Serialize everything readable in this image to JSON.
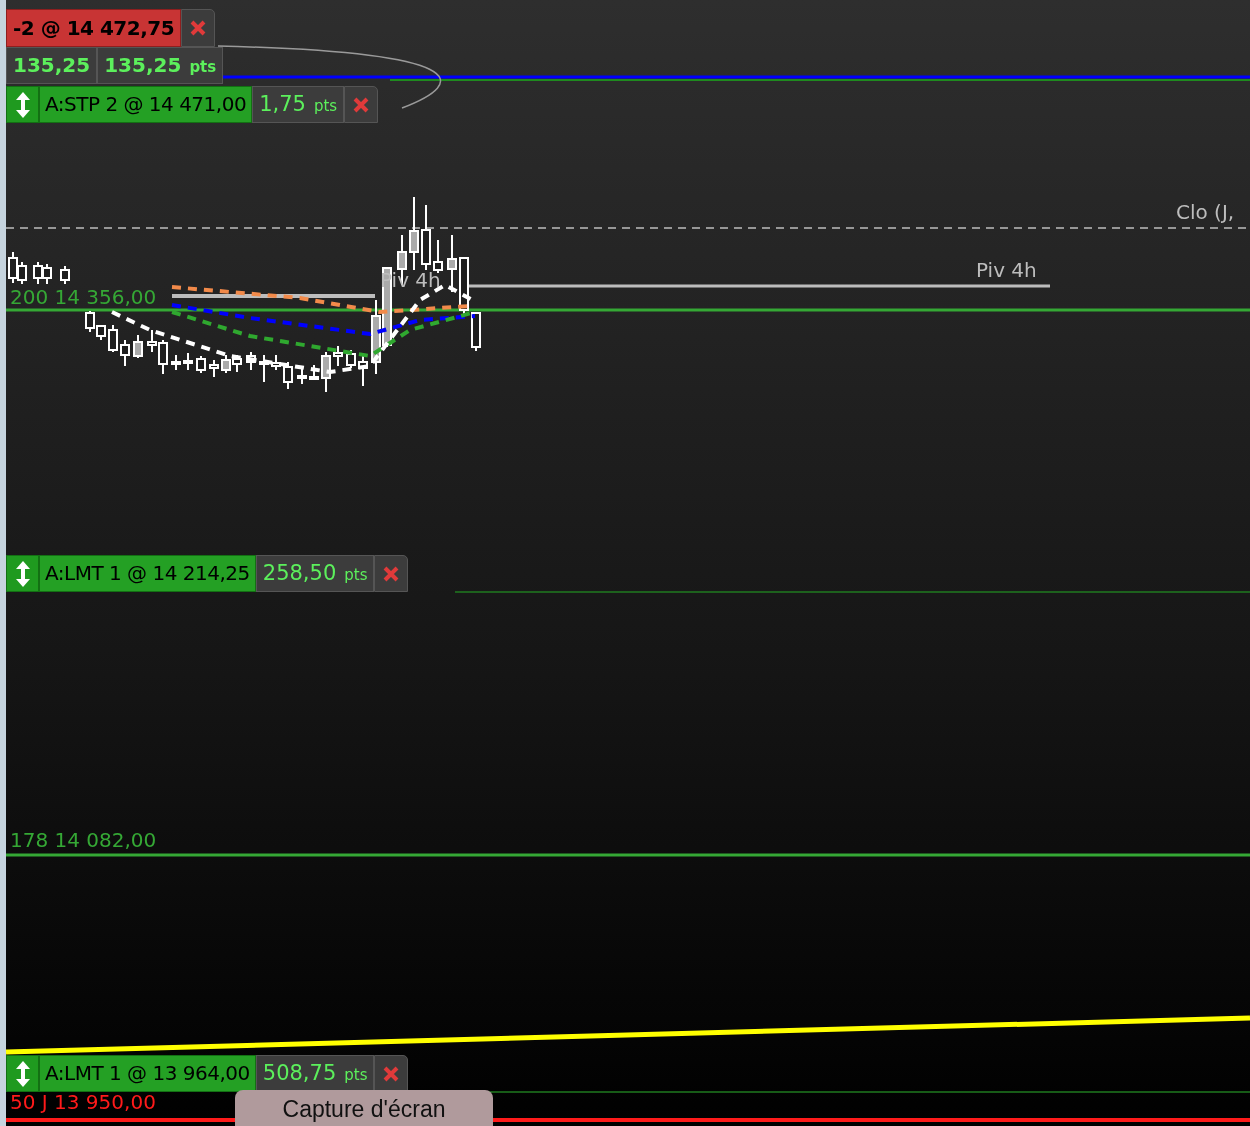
{
  "position": {
    "label": "-2 @ 14 472,75",
    "pnl": "135,25",
    "pnl_pts": "135,25",
    "unit": "pts"
  },
  "orders": [
    {
      "label": "A:STP  2 @ 14 471,00",
      "distance": "1,75",
      "unit": "pts"
    },
    {
      "label": "A:LMT  1 @ 14 214,25",
      "distance": "258,50",
      "unit": "pts"
    },
    {
      "label": "A:LMT  1 @ 13 964,00",
      "distance": "508,75",
      "unit": "pts"
    }
  ],
  "levels": [
    {
      "label": "Clo (J,",
      "color": "#bdbdbd"
    },
    {
      "label": "Piv 4h",
      "color": "#bdbdbd"
    },
    {
      "label": "Piv 4h",
      "color": "#bdbdbd"
    },
    {
      "label": "200 14 356,00",
      "color": "#35a835"
    },
    {
      "label": "178 14 082,00",
      "color": "#35a835"
    },
    {
      "label": "50 J 13 950,00",
      "color": "#ff1a1a"
    }
  ],
  "tooltip": "Capture d'écran"
}
